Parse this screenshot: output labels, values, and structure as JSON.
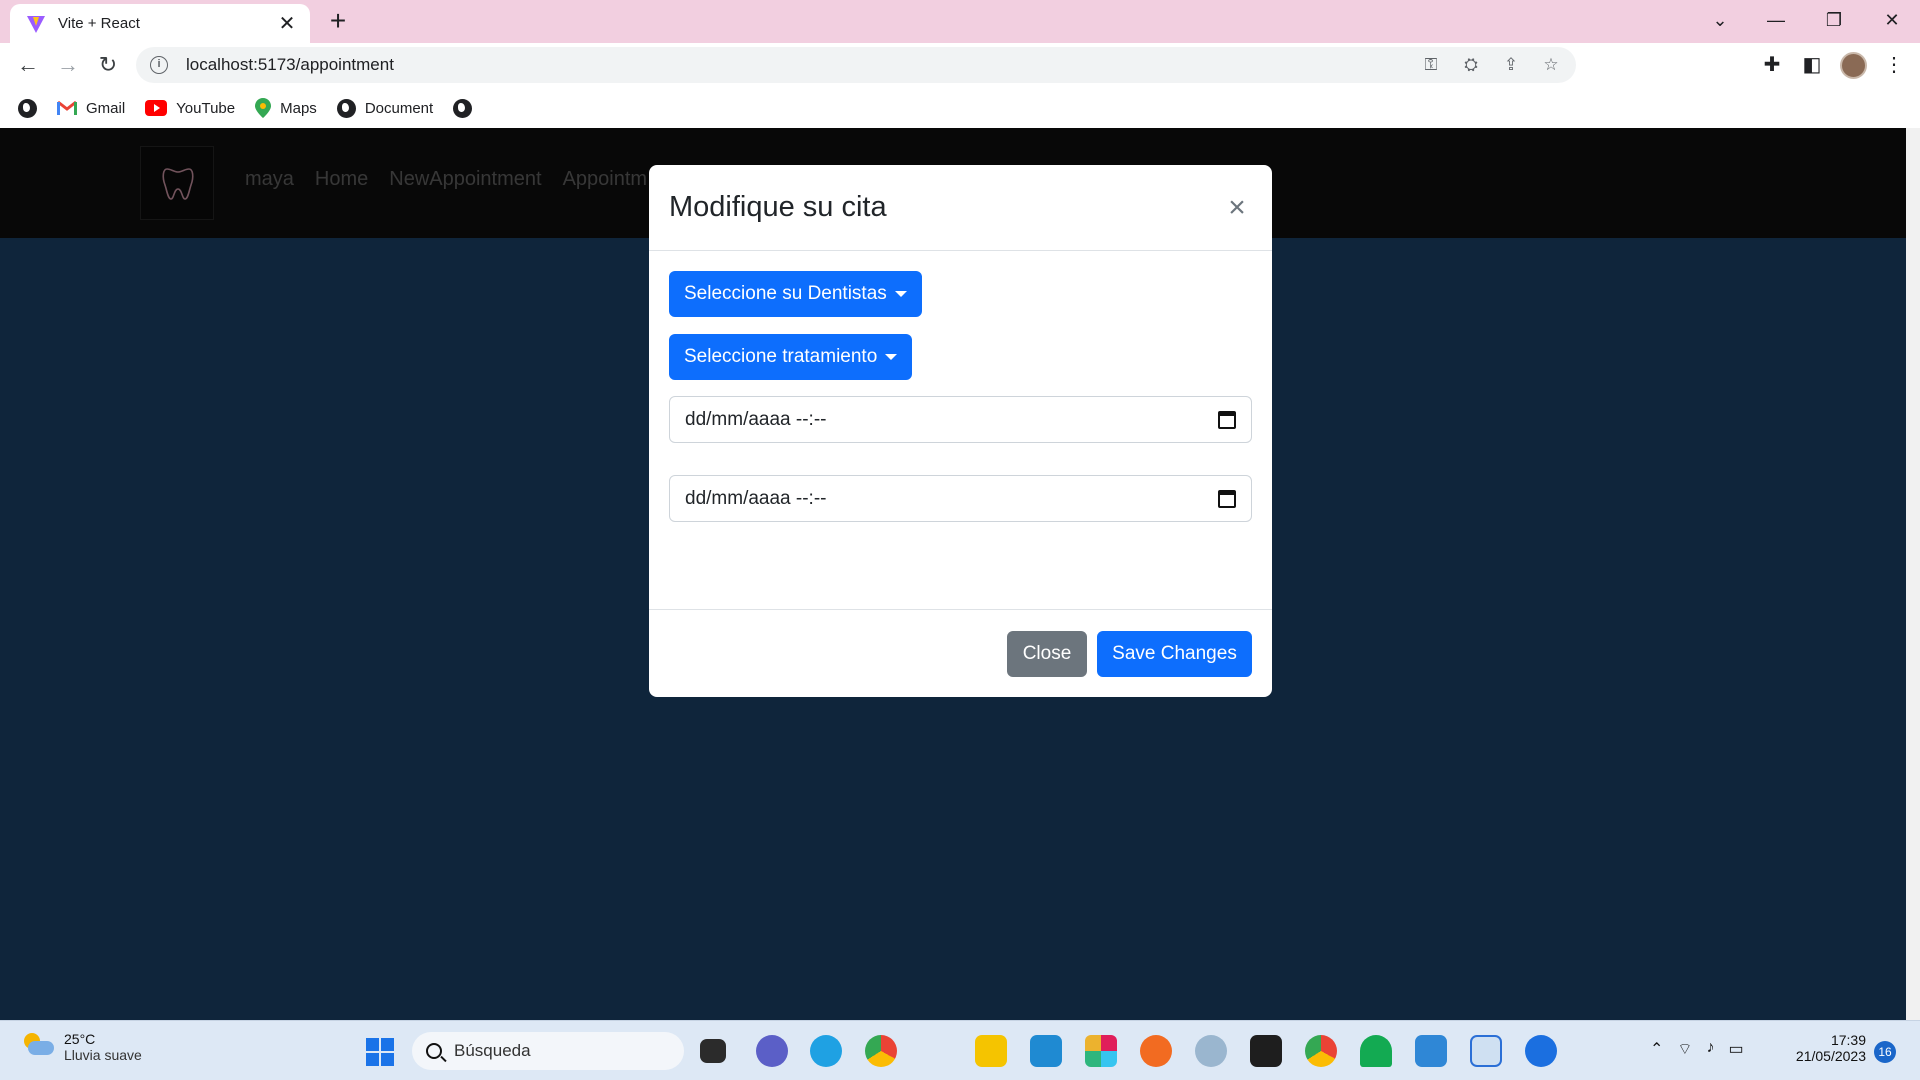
{
  "browser": {
    "tab_title": "Vite + React",
    "tab_close": "✕",
    "new_tab": "+",
    "url": "localhost:5173/appointment",
    "window_controls": {
      "minimize": "—",
      "restore": "❐",
      "close": "✕",
      "tabsearch": "⌄"
    },
    "nav": {
      "back": "←",
      "forward": "→",
      "reload": "↻"
    }
  },
  "bookmarks": [
    {
      "label": ""
    },
    {
      "label": "Gmail"
    },
    {
      "label": "YouTube"
    },
    {
      "label": "Maps"
    },
    {
      "label": "Document"
    },
    {
      "label": ""
    }
  ],
  "app_nav": {
    "links": [
      "maya",
      "Home",
      "NewAppointment",
      "Appointm"
    ]
  },
  "modal": {
    "title": "Modifique su cita",
    "close_x": "×",
    "dentist_dropdown": "Seleccione su Dentistas",
    "treatment_dropdown": "Seleccione tratamiento",
    "date_start": "dd/mm/aaaa --:--",
    "date_end": "dd/mm/aaaa --:--",
    "close_button": "Close",
    "save_button": "Save Changes"
  },
  "taskbar": {
    "weather_temp": "25°C",
    "weather_desc": "Lluvia suave",
    "search_placeholder": "Búsqueda",
    "time": "17:39",
    "date": "21/05/2023",
    "notifications": "16"
  },
  "colors": {
    "primary": "#0d6efd",
    "secondary": "#6c757d",
    "page_bg": "#1f4a77",
    "nav_bg": "#111111",
    "tab_strip": "#f2cfe0"
  }
}
